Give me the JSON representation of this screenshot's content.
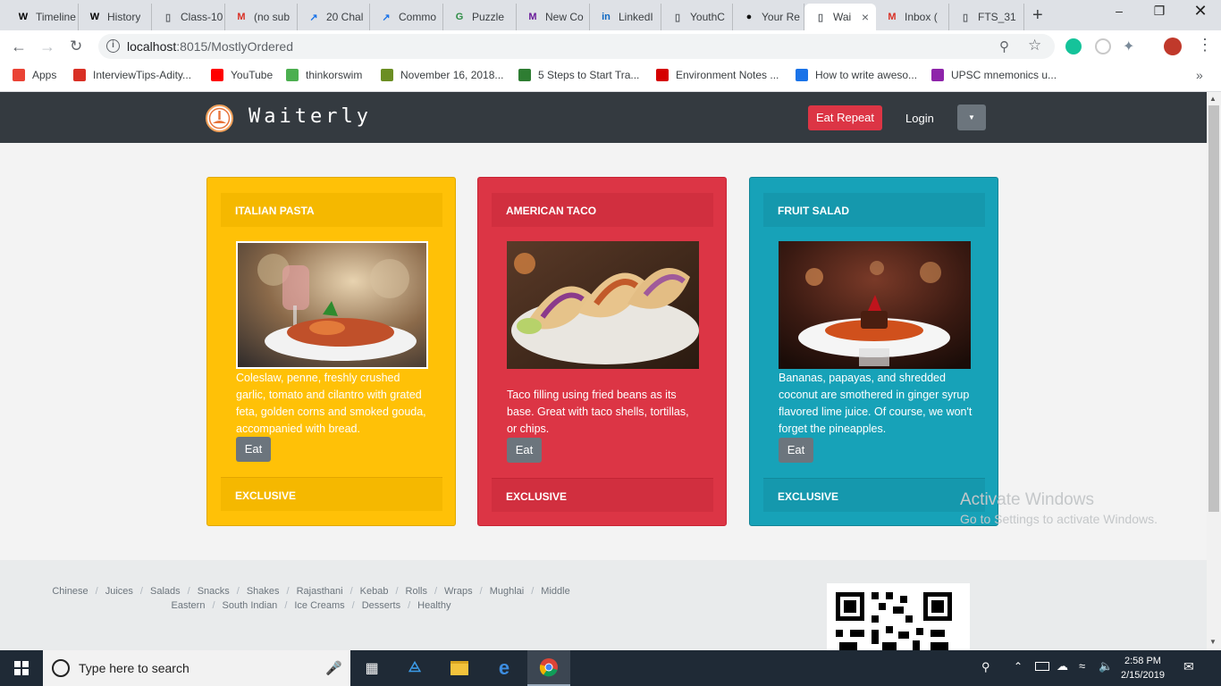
{
  "browser": {
    "tabs": [
      {
        "label": "Timeline",
        "icon": "wikipedia-icon"
      },
      {
        "label": "History",
        "icon": "wikipedia-icon"
      },
      {
        "label": "Class-10",
        "icon": "document-icon"
      },
      {
        "label": "(no sub",
        "icon": "gmail-icon"
      },
      {
        "label": "20 Chal",
        "icon": "chart-icon"
      },
      {
        "label": "Commo",
        "icon": "chart-icon"
      },
      {
        "label": "Puzzle",
        "icon": "gfg-icon"
      },
      {
        "label": "New Co",
        "icon": "m-icon"
      },
      {
        "label": "LinkedI",
        "icon": "linkedin-icon"
      },
      {
        "label": "YouthC",
        "icon": "document-icon"
      },
      {
        "label": "Your Re",
        "icon": "github-icon"
      },
      {
        "label": "Wai",
        "icon": "document-icon",
        "active": true
      },
      {
        "label": "Inbox (",
        "icon": "gmail-icon"
      },
      {
        "label": "FTS_31",
        "icon": "document-icon"
      }
    ],
    "url_host": "localhost",
    "url_path": ":8015/MostlyOrdered",
    "bookmarks": [
      {
        "label": "Apps",
        "color": "#ea4335"
      },
      {
        "label": "InterviewTips-Adity...",
        "color": "#d93025"
      },
      {
        "label": "YouTube",
        "color": "#ff0000"
      },
      {
        "label": "thinkorswim",
        "color": "#4caf50"
      },
      {
        "label": "November 16, 2018...",
        "color": "#6b8e23"
      },
      {
        "label": "5 Steps to Start Tra...",
        "color": "#2e7d32"
      },
      {
        "label": "Environment Notes ...",
        "color": "#d50000"
      },
      {
        "label": "How to write aweso...",
        "color": "#1a73e8"
      },
      {
        "label": "UPSC mnemonics u...",
        "color": "#8e24aa"
      }
    ]
  },
  "app": {
    "brand": "Waiterly",
    "eat_repeat": "Eat Repeat",
    "login": "Login",
    "dropdown_caret": "▼"
  },
  "cards": [
    {
      "title": "ITALIAN PASTA",
      "description": "Coleslaw, penne, freshly crushed garlic, tomato and cilantro with grated feta, golden corns and smoked gouda, accompanied with bread.",
      "button": "Eat",
      "footer": "EXCLUSIVE",
      "bg": "#ffc107",
      "bar": "#f5b800",
      "text_color": "#ffffff"
    },
    {
      "title": "AMERICAN TACO",
      "description": "Taco filling using fried beans as its base. Great with taco shells, tortillas, or chips.",
      "button": "Eat",
      "footer": "EXCLUSIVE",
      "bg": "#dc3545",
      "bar": "#d12f3f",
      "text_color": "#ffffff"
    },
    {
      "title": "FRUIT SALAD",
      "description": "Bananas, papayas, and shredded coconut are smothered in ginger syrup flavored lime juice. Of course, we won't forget the pineapples.",
      "button": "Eat",
      "footer": "EXCLUSIVE",
      "bg": "#17a2b8",
      "bar": "#1598ad",
      "text_color": "#ffffff"
    }
  ],
  "footer": {
    "categories": [
      "Chinese",
      "Juices",
      "Salads",
      "Snacks",
      "Shakes",
      "Rajasthani",
      "Kebab",
      "Rolls",
      "Wraps",
      "Mughlai",
      "Middle Eastern",
      "South Indian",
      "Ice Creams",
      "Desserts",
      "Healthy"
    ]
  },
  "watermark": {
    "line1": "Activate Windows",
    "line2": "Go to Settings to activate Windows."
  },
  "taskbar": {
    "search_placeholder": "Type here to search",
    "time": "2:58 PM",
    "date": "2/15/2019"
  }
}
